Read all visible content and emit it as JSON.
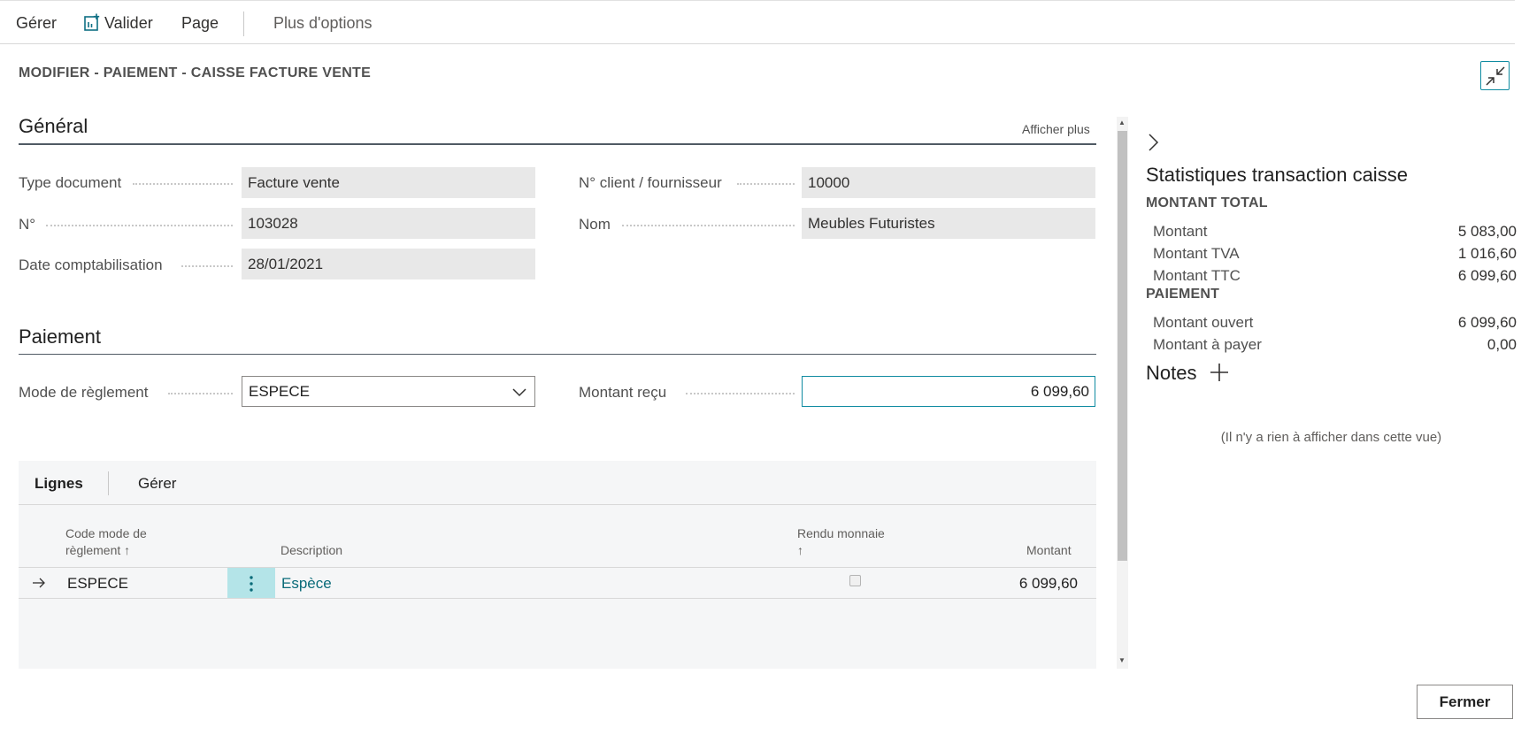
{
  "actionbar": {
    "manage": "Gérer",
    "validate": "Valider",
    "page": "Page",
    "more": "Plus d'options"
  },
  "page_title": "MODIFIER - PAIEMENT - CAISSE FACTURE VENTE",
  "general": {
    "title": "Général",
    "show_more": "Afficher plus",
    "fields": {
      "doc_type_label": "Type document",
      "doc_type_value": "Facture vente",
      "no_label": "N°",
      "no_value": "103028",
      "posting_date_label": "Date comptabilisation",
      "posting_date_value": "28/01/2021",
      "customer_no_label": "N° client / fournisseur",
      "customer_no_value": "10000",
      "name_label": "Nom",
      "name_value": "Meubles Futuristes"
    }
  },
  "payment": {
    "title": "Paiement",
    "method_label": "Mode de règlement",
    "method_value": "ESPECE",
    "received_label": "Montant reçu",
    "received_value": "6 099,60"
  },
  "lines": {
    "tabs": {
      "lines": "Lignes",
      "manage": "Gérer"
    },
    "headers": {
      "code_line1": "Code mode de",
      "code_line2": "règlement ↑",
      "description": "Description",
      "change_line1": "Rendu monnaie",
      "change_line2": "↑",
      "amount": "Montant"
    },
    "rows": [
      {
        "code": "ESPECE",
        "description": "Espèce",
        "change": false,
        "amount": "6 099,60"
      }
    ]
  },
  "factbox": {
    "title": "Statistiques transaction caisse",
    "total_group": "MONTANT TOTAL",
    "amount_label": "Montant",
    "amount_value": "5 083,00",
    "vat_label": "Montant TVA",
    "vat_value": "1 016,60",
    "incl_vat_label": "Montant TTC",
    "incl_vat_value": "6 099,60",
    "payment_group": "PAIEMENT",
    "open_label": "Montant ouvert",
    "open_value": "6 099,60",
    "to_pay_label": "Montant à payer",
    "to_pay_value": "0,00",
    "notes_title": "Notes",
    "empty_text": "(Il n'y a rien à afficher dans cette vue)"
  },
  "footer": {
    "close": "Fermer"
  },
  "colors": {
    "accent": "#0f8ba1",
    "link": "#0a6b79",
    "selected_cell": "#b4e4e8"
  }
}
